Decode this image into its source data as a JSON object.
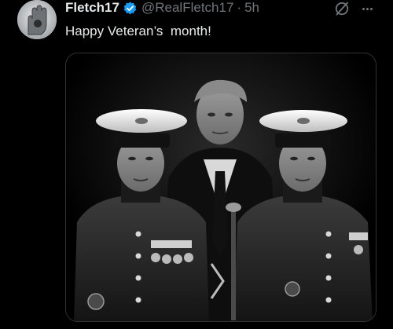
{
  "post": {
    "author": {
      "display_name": "Fletch17",
      "handle": "@RealFletch17",
      "verified": true,
      "verified_color": "#1d9bf0"
    },
    "separator": "·",
    "time": "5h",
    "text": "Happy Veteran’s  month!",
    "icons": {
      "grok": "grok-slash-icon",
      "more": "more-horizontal-icon"
    },
    "media": {
      "kind": "photo",
      "tone": "black-and-white"
    }
  },
  "colors": {
    "background": "#000000",
    "primary_text": "#e7e9ea",
    "secondary_text": "#71767b",
    "border": "#2f3336"
  }
}
